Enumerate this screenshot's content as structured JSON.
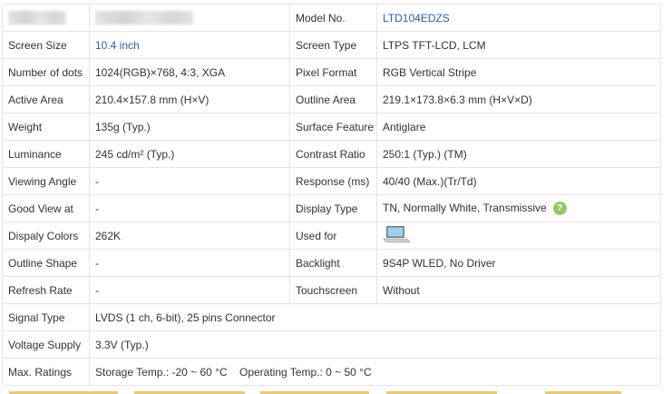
{
  "rows": [
    {
      "l1": "",
      "v1": "",
      "l2": "Model No.",
      "v2": "LTD104EDZS"
    },
    {
      "l1": "Screen Size",
      "v1": "10.4 inch",
      "l2": "Screen Type",
      "v2": "LTPS TFT-LCD, LCM"
    },
    {
      "l1": "Number of dots",
      "v1": "1024(RGB)×768, 4:3, XGA",
      "l2": "Pixel Format",
      "v2": "RGB Vertical Stripe"
    },
    {
      "l1": "Active Area",
      "v1": "210.4×157.8 mm (H×V)",
      "l2": "Outline Area",
      "v2": "219.1×173.8×6.3 mm (H×V×D)"
    },
    {
      "l1": "Weight",
      "v1": "135g (Typ.)",
      "l2": "Surface Feature",
      "v2": "Antiglare"
    },
    {
      "l1": "Luminance",
      "v1": "245 cd/m² (Typ.)",
      "l2": "Contrast Ratio",
      "v2": "250:1 (Typ.) (TM)"
    },
    {
      "l1": "Viewing Angle",
      "v1": "-",
      "l2": "Response (ms)",
      "v2": "40/40 (Max.)(Tr/Td)"
    },
    {
      "l1": "Good View at",
      "v1": "-",
      "l2": "Display Type",
      "v2": "TN, Normally White, Transmissive"
    },
    {
      "l1": "Dispaly Colors",
      "v1": "262K",
      "l2": "Used for",
      "v2": ""
    },
    {
      "l1": "Outline Shape",
      "v1": "-",
      "l2": "Backlight",
      "v2": "9S4P WLED, No Driver"
    },
    {
      "l1": "Refresh Rate",
      "v1": "-",
      "l2": "Touchscreen",
      "v2": "Without"
    },
    {
      "l1": "Signal Type",
      "v1": "LVDS (1 ch, 6-bit), 25 pins Connector"
    },
    {
      "l1": "Voltage Supply",
      "v1": "3.3V (Typ.)"
    },
    {
      "l1": "Max. Ratings",
      "v1": "Storage Temp.: -20 ~ 60 °C    Operating Temp.: 0 ~ 50 °C"
    }
  ],
  "help_icon_glyph": "?",
  "used_for_icon": "laptop-icon",
  "colors": {
    "link": "#2e5fa8",
    "border": "#e6e6e6",
    "help": "#9bc46d",
    "tab": "#f0c86a"
  }
}
